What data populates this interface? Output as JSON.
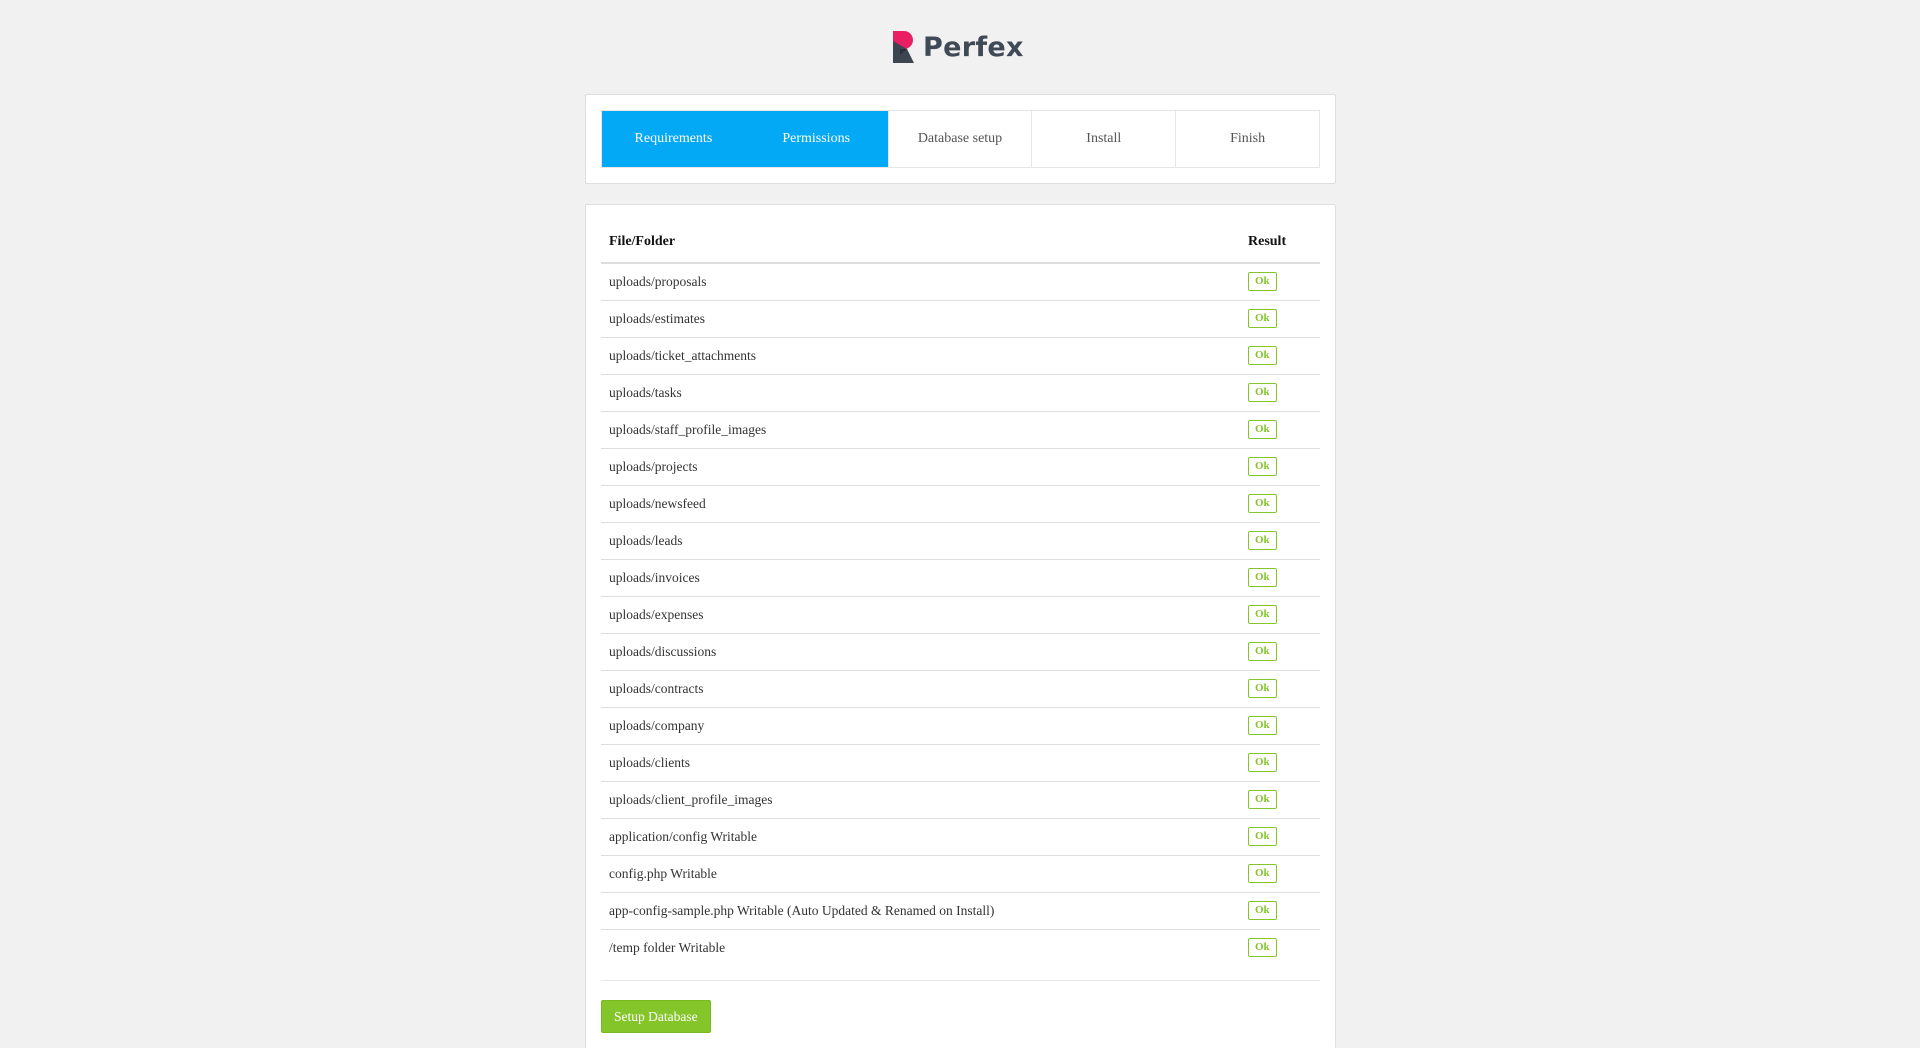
{
  "brand": {
    "name": "Perfex",
    "colors": {
      "primary": "#03a9f4",
      "success": "#84c529"
    }
  },
  "steps": [
    {
      "label": "Requirements",
      "state": "done"
    },
    {
      "label": "Permissions",
      "state": "done"
    },
    {
      "label": "Database setup",
      "state": "pending"
    },
    {
      "label": "Install",
      "state": "pending"
    },
    {
      "label": "Finish",
      "state": "pending"
    }
  ],
  "table": {
    "headers": {
      "path": "File/Folder",
      "result": "Result"
    },
    "rows": [
      {
        "path": "uploads/proposals",
        "result": "Ok"
      },
      {
        "path": "uploads/estimates",
        "result": "Ok"
      },
      {
        "path": "uploads/ticket_attachments",
        "result": "Ok"
      },
      {
        "path": "uploads/tasks",
        "result": "Ok"
      },
      {
        "path": "uploads/staff_profile_images",
        "result": "Ok"
      },
      {
        "path": "uploads/projects",
        "result": "Ok"
      },
      {
        "path": "uploads/newsfeed",
        "result": "Ok"
      },
      {
        "path": "uploads/leads",
        "result": "Ok"
      },
      {
        "path": "uploads/invoices",
        "result": "Ok"
      },
      {
        "path": "uploads/expenses",
        "result": "Ok"
      },
      {
        "path": "uploads/discussions",
        "result": "Ok"
      },
      {
        "path": "uploads/contracts",
        "result": "Ok"
      },
      {
        "path": "uploads/company",
        "result": "Ok"
      },
      {
        "path": "uploads/clients",
        "result": "Ok"
      },
      {
        "path": "uploads/client_profile_images",
        "result": "Ok"
      },
      {
        "path": "application/config Writable",
        "result": "Ok"
      },
      {
        "path": "config.php Writable",
        "result": "Ok"
      },
      {
        "path": "app-config-sample.php Writable (Auto Updated & Renamed on Install)",
        "result": "Ok"
      },
      {
        "path": "/temp folder Writable",
        "result": "Ok"
      }
    ]
  },
  "actions": {
    "setup_database_label": "Setup Database"
  }
}
